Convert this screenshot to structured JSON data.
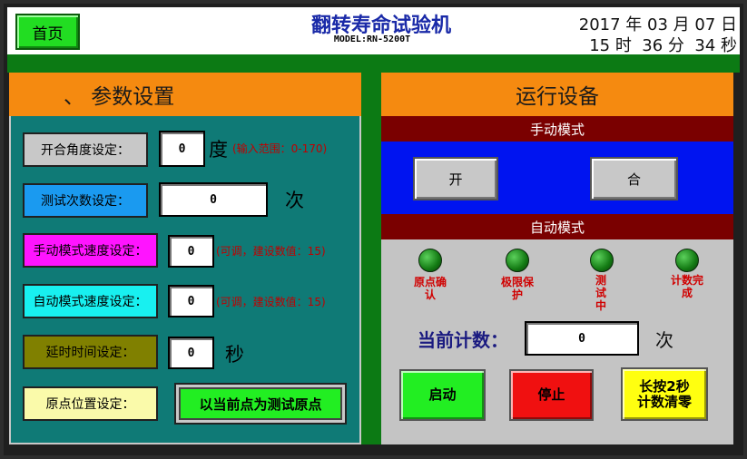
{
  "header": {
    "home_label": "首页",
    "title": "翻转寿命试验机",
    "model": "MODEL:RN-5200T",
    "date": "2017 年 03 月 07 日",
    "time": "15 时  36 分  34 秒"
  },
  "left": {
    "title": "、 参数设置",
    "rows": [
      {
        "label": "开合角度设定：",
        "value": "0",
        "unit": "度",
        "hint": "(输入范围：0-170)"
      },
      {
        "label": "测试次数设定：",
        "value": "0",
        "unit": "次",
        "hint": ""
      },
      {
        "label": "手动模式速度设定：",
        "value": "0",
        "unit": "",
        "hint": "(可调，建设数值：15)"
      },
      {
        "label": "自动模式速度设定：",
        "value": "0",
        "unit": "",
        "hint": "(可调，建设数值：15)"
      },
      {
        "label": "延时时间设定：",
        "value": "0",
        "unit": "秒",
        "hint": ""
      },
      {
        "label": "原点位置设定：",
        "value": "",
        "unit": "",
        "hint": ""
      }
    ],
    "set_origin_button": "以当前点为测试原点"
  },
  "right": {
    "title": "运行设备",
    "manual_mode_label": "手动模式",
    "open_button": "开",
    "close_button": "合",
    "auto_mode_label": "自动模式",
    "lamps": [
      "原点确认",
      "极限保护",
      "测试中",
      "计数完成"
    ],
    "count_label": "当前计数：",
    "count_value": "0",
    "count_unit": "次",
    "start_button": "启动",
    "stop_button": "停止",
    "reset_button_line1": "长按2秒",
    "reset_button_line2": "计数清零"
  },
  "colors": {
    "home": "#22dd22",
    "orange": "#f58a10",
    "teal": "#0f7a76",
    "blue": "#0014f0",
    "maroon": "#7a0000",
    "green": "#0c7a14"
  }
}
